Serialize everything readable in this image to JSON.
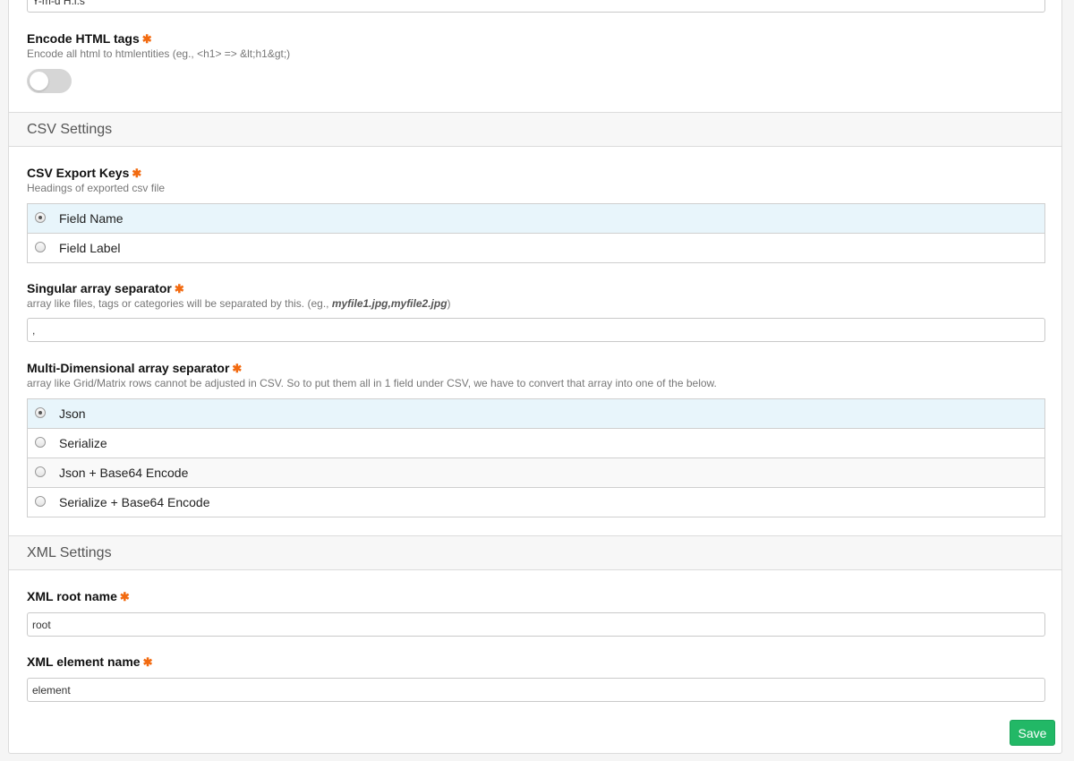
{
  "top_field": {
    "value": "Y-m-d H:i:s"
  },
  "encode_html": {
    "label": "Encode HTML tags",
    "required_mark": "✱",
    "description": "Encode all html to htmlentities (eg., <h1> => &lt;h1&gt;)",
    "enabled": false
  },
  "csv_settings": {
    "title": "CSV Settings",
    "export_keys": {
      "label": "CSV Export Keys",
      "description": "Headings of exported csv file",
      "options": [
        "Field Name",
        "Field Label"
      ],
      "selected": "Field Name"
    },
    "singular_separator": {
      "label": "Singular array separator",
      "description_prefix": "array like files, tags or categories will be separated by this. (eg., ",
      "description_example": "myfile1.jpg,myfile2.jpg",
      "description_suffix": ")",
      "value": ","
    },
    "multi_separator": {
      "label": "Multi-Dimensional array separator",
      "description": "array like Grid/Matrix rows cannot be adjusted in CSV. So to put them all in 1 field under CSV, we have to convert that array into one of the below.",
      "options": [
        "Json",
        "Serialize",
        "Json + Base64 Encode",
        "Serialize + Base64 Encode"
      ],
      "selected": "Json"
    }
  },
  "xml_settings": {
    "title": "XML Settings",
    "root_name": {
      "label": "XML root name",
      "value": "root"
    },
    "element_name": {
      "label": "XML element name",
      "value": "element"
    }
  },
  "save_label": "Save",
  "colors": {
    "required": "#f26a10",
    "save": "#22b866",
    "selected_row": "#e8f5fb"
  }
}
